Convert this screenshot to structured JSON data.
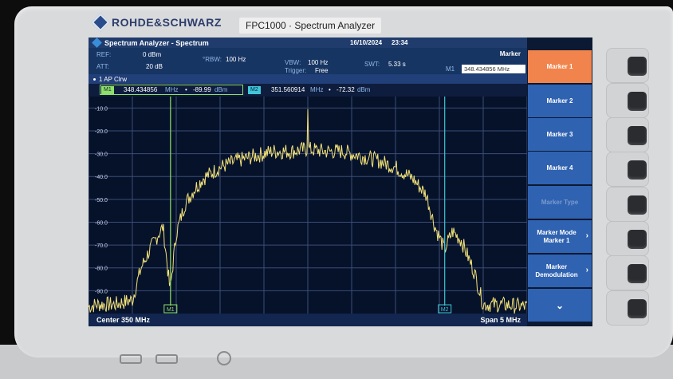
{
  "device": {
    "brand": "ROHDE&SCHWARZ",
    "model": "FPC1000 · Spectrum Analyzer"
  },
  "window": {
    "title": "Spectrum Analyzer - Spectrum",
    "date": "16/10/2024",
    "time": "23:34"
  },
  "params": {
    "ref_label": "REF:",
    "ref_value": "0 dBm",
    "att_label": "ATT:",
    "att_value": "20 dB",
    "rbw_label": "°RBW:",
    "rbw_value": "100 Hz",
    "vbw_label": "VBW:",
    "vbw_value": "100 Hz",
    "trigger_label": "Trigger:",
    "trigger_value": "Free",
    "swt_label": "SWT:",
    "swt_value": "5.33 s"
  },
  "marker_panel": {
    "title": "Marker",
    "m1_label": "M1",
    "m1_input": "348.434856 MHz"
  },
  "mode": {
    "label": "1 AP Clrw"
  },
  "markers": {
    "m1_tag": "M1",
    "m1_freq": "348.434856",
    "m1_unit": "MHz",
    "m1_level": "-89.99",
    "m1_level_unit": "dBm",
    "m2_tag": "M2",
    "m2_freq": "351.560914",
    "m2_unit": "MHz",
    "m2_level": "-72.32",
    "m2_level_unit": "dBm"
  },
  "footer": {
    "center": "Center 350 MHz",
    "span": "Span 5 MHz"
  },
  "softkeys": [
    {
      "label": "Marker 1",
      "state": "active"
    },
    {
      "label": "Marker 2",
      "state": "normal"
    },
    {
      "label": "Marker 3",
      "state": "normal"
    },
    {
      "label": "Marker 4",
      "state": "normal"
    },
    {
      "label": "Marker Type",
      "state": "disabled"
    },
    {
      "label": "Marker Mode Marker 1",
      "state": "submenu"
    },
    {
      "label": "Marker Demodulation",
      "state": "submenu"
    },
    {
      "label": "⌄",
      "state": "more"
    }
  ],
  "colors": {
    "trace": "#f3e27a",
    "marker1": "#8fe06b",
    "marker2": "#3fc6d8",
    "active_softkey": "#f1844c"
  },
  "chart_data": {
    "type": "line",
    "title": "",
    "xlabel": "",
    "ylabel": "",
    "y_ticks": [
      "-10.0",
      "-20.0",
      "-30.0",
      "-40.0",
      "-50.0",
      "-60.0",
      "-70.0",
      "-80.0",
      "-90.0"
    ],
    "xlim_mhz": [
      347.5,
      352.5
    ],
    "ylim_dbm": [
      -100,
      -5
    ],
    "series": [
      {
        "x_mhz": [
          347.5,
          347.6,
          347.8,
          348.0,
          348.1,
          348.2,
          348.3,
          348.35,
          348.43,
          348.5,
          348.6,
          348.7,
          348.8,
          349.0,
          349.2,
          349.4,
          349.6,
          349.8,
          350.0,
          350.2,
          350.4,
          350.6,
          350.8,
          351.0,
          351.2,
          351.35,
          351.45,
          351.56,
          351.65,
          351.75,
          351.9,
          352.0,
          352.2,
          352.5
        ],
        "y_dbm": [
          -97,
          -96,
          -96,
          -94,
          -80,
          -72,
          -65,
          -62,
          -90,
          -65,
          -52,
          -46,
          -41,
          -36,
          -33,
          -31,
          -29,
          -29,
          -28,
          -29,
          -29,
          -31,
          -33,
          -36,
          -41,
          -48,
          -62,
          -72,
          -64,
          -68,
          -82,
          -96,
          -96,
          -97
        ]
      }
    ],
    "spike": {
      "x_mhz": 350.0,
      "y_dbm": -10.5
    },
    "markers": [
      {
        "name": "M1",
        "x_mhz": 348.434856,
        "y_dbm": -89.99
      },
      {
        "name": "M2",
        "x_mhz": 351.560914,
        "y_dbm": -72.32
      }
    ],
    "grid": true
  }
}
